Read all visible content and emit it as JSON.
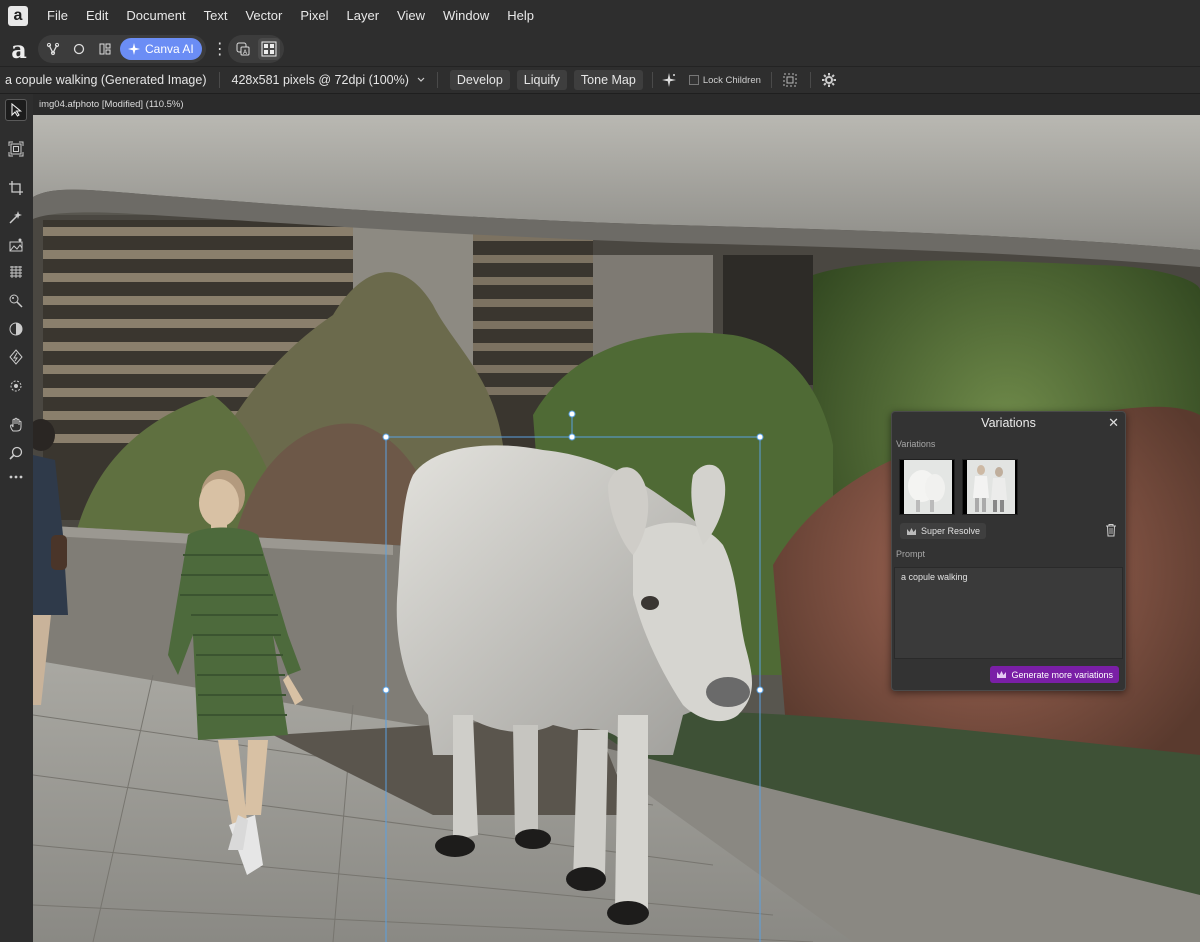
{
  "menu": {
    "items": [
      "File",
      "Edit",
      "Document",
      "Text",
      "Vector",
      "Pixel",
      "Layer",
      "View",
      "Window",
      "Help"
    ]
  },
  "toolbar": {
    "canva_ai_label": "Canva AI"
  },
  "context": {
    "layer_title": "a copule walking (Generated Image)",
    "image_size": "428x581 pixels @ 72dpi (100%)",
    "develop": "Develop",
    "liquify": "Liquify",
    "tone_map": "Tone Map",
    "lock_children": "Lock Children"
  },
  "document": {
    "tab_title": "img04.afphoto [Modified] (110.5%)"
  },
  "variations": {
    "title": "Variations",
    "section_variations": "Variations",
    "super_resolve": "Super Resolve",
    "section_prompt": "Prompt",
    "prompt_text": "a copule walking",
    "generate_button": "Generate more variations"
  },
  "colors": {
    "accent": "#6b8df5",
    "generate": "#7a1fa6",
    "selection": "#5aa0e0"
  }
}
